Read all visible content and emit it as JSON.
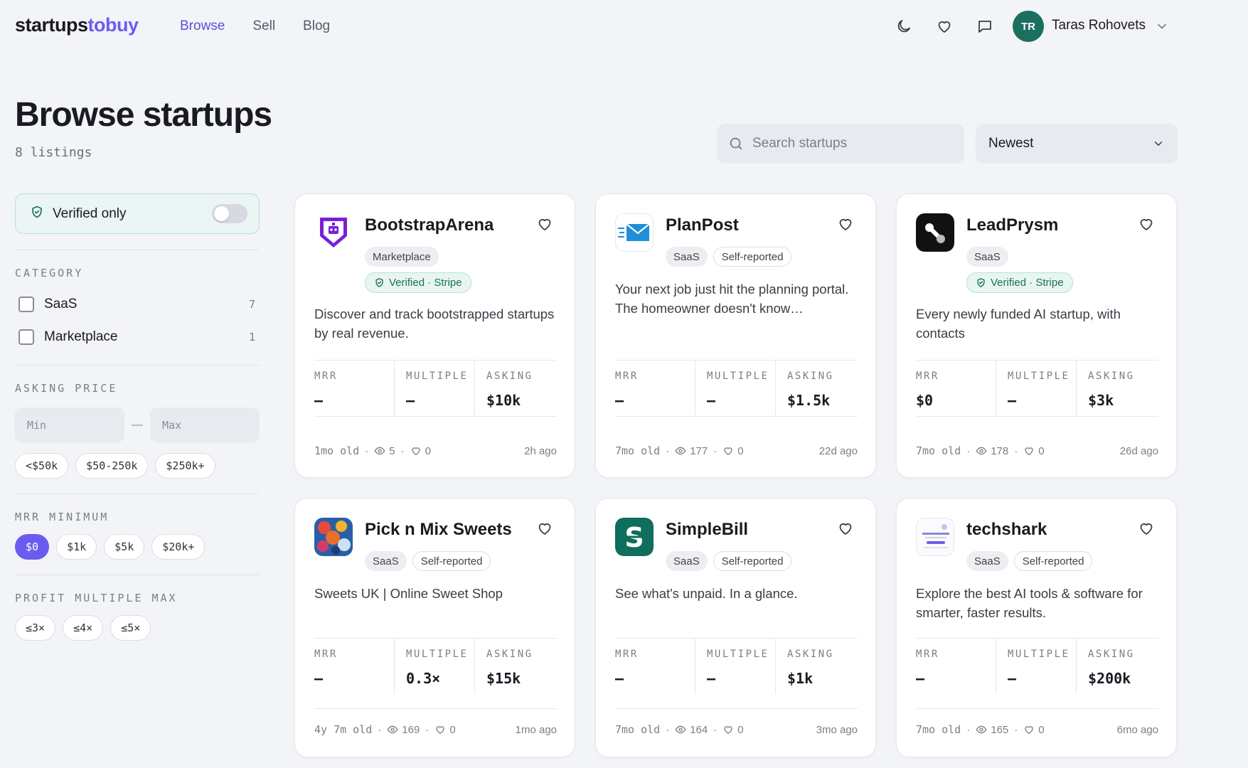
{
  "header": {
    "logo_part1": "startups",
    "logo_part2": "tobuy",
    "nav": [
      "Browse",
      "Sell",
      "Blog"
    ],
    "user_initials": "TR",
    "user_name": "Taras Rohovets"
  },
  "page": {
    "title": "Browse startups",
    "count": "8 listings",
    "search_placeholder": "Search startups",
    "sort_value": "Newest"
  },
  "filters": {
    "verified_label": "Verified only",
    "category_title": "CATEGORY",
    "categories": [
      {
        "label": "SaaS",
        "count": "7"
      },
      {
        "label": "Marketplace",
        "count": "1"
      }
    ],
    "price_title": "ASKING PRICE",
    "price_min_placeholder": "Min",
    "price_max_placeholder": "Max",
    "price_dash": "—",
    "price_chips": [
      "<$50k",
      "$50-250k",
      "$250k+"
    ],
    "mrr_title": "MRR MINIMUM",
    "mrr_chips": [
      "$0",
      "$1k",
      "$5k",
      "$20k+"
    ],
    "multiple_title": "PROFIT MULTIPLE MAX",
    "multiple_chips": [
      "≤3×",
      "≤4×",
      "≤5×"
    ]
  },
  "labels": {
    "mrr": "MRR",
    "multiple": "MULTIPLE",
    "asking": "ASKING",
    "verified_badge": "Verified · Stripe"
  },
  "cards": [
    {
      "name": "BootstrapArena",
      "tags": [
        "Marketplace"
      ],
      "verified": true,
      "desc": "Discover and track bootstrapped startups by real revenue.",
      "mrr": "–",
      "multiple": "–",
      "asking": "$10k",
      "age": "1mo old",
      "views": "5",
      "likes": "0",
      "ago": "2h ago"
    },
    {
      "name": "PlanPost",
      "tags": [
        "SaaS",
        "Self-reported"
      ],
      "verified": false,
      "desc": "Your next job just hit the planning portal. The homeowner doesn't know…",
      "mrr": "–",
      "multiple": "–",
      "asking": "$1.5k",
      "age": "7mo old",
      "views": "177",
      "likes": "0",
      "ago": "22d ago"
    },
    {
      "name": "LeadPrysm",
      "tags": [
        "SaaS"
      ],
      "verified": true,
      "desc": "Every newly funded AI startup, with contacts",
      "mrr": "$0",
      "multiple": "–",
      "asking": "$3k",
      "age": "7mo old",
      "views": "178",
      "likes": "0",
      "ago": "26d ago"
    },
    {
      "name": "Pick n Mix Sweets",
      "tags": [
        "SaaS",
        "Self-reported"
      ],
      "verified": false,
      "desc": "Sweets UK | Online Sweet Shop",
      "mrr": "–",
      "multiple": "0.3×",
      "asking": "$15k",
      "age": "4y 7m old",
      "views": "169",
      "likes": "0",
      "ago": "1mo ago"
    },
    {
      "name": "SimpleBill",
      "tags": [
        "SaaS",
        "Self-reported"
      ],
      "verified": false,
      "desc": "See what's unpaid. In a glance.",
      "mrr": "–",
      "multiple": "–",
      "asking": "$1k",
      "age": "7mo old",
      "views": "164",
      "likes": "0",
      "ago": "3mo ago"
    },
    {
      "name": "techshark",
      "tags": [
        "SaaS",
        "Self-reported"
      ],
      "verified": false,
      "desc": "Explore the best AI tools & software for smarter, faster results.",
      "mrr": "–",
      "multiple": "–",
      "asking": "$200k",
      "age": "7mo old",
      "views": "165",
      "likes": "0",
      "ago": "6mo ago"
    }
  ],
  "colors": {
    "accent": "#6b5cf0",
    "verified": "#1a6f5e",
    "background": "#f3f4f8"
  }
}
